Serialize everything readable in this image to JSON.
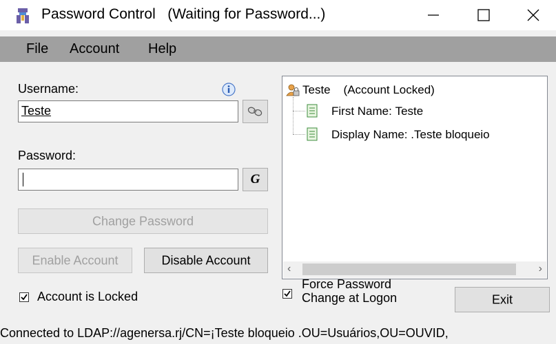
{
  "window": {
    "title": "Password Control",
    "status": "(Waiting for Password...)",
    "controls": [
      "minimize-icon",
      "maximize-icon",
      "close-icon"
    ]
  },
  "menu": {
    "file": "File",
    "account": "Account",
    "help": "Help"
  },
  "form": {
    "username_label": "Username:",
    "username_value": "Teste",
    "password_label": "Password:",
    "password_value": "",
    "generate_label": "G",
    "change_password": "Change Password",
    "enable_account": "Enable Account",
    "disable_account": "Disable Account",
    "account_locked_label": "Account is Locked",
    "account_locked_checked": true,
    "force_change_line1": "Force Password",
    "force_change_line2": "Change at Logon",
    "force_change_checked": true,
    "exit": "Exit"
  },
  "tree": {
    "root_name": "Teste",
    "root_status": "(Account Locked)",
    "children": [
      {
        "label": "First Name:",
        "value": "Teste"
      },
      {
        "label": "Display Name:",
        "value": ".Teste bloqueio"
      }
    ]
  },
  "status_bar": {
    "text": "Connected to LDAP://agenersa.rj/CN=¡Teste bloqueio .OU=Usuários,OU=OUVID,"
  },
  "colors": {
    "menubar": "#a0a0a0",
    "disabled_text": "#a0a0a0",
    "background": "#f0f0f0"
  }
}
